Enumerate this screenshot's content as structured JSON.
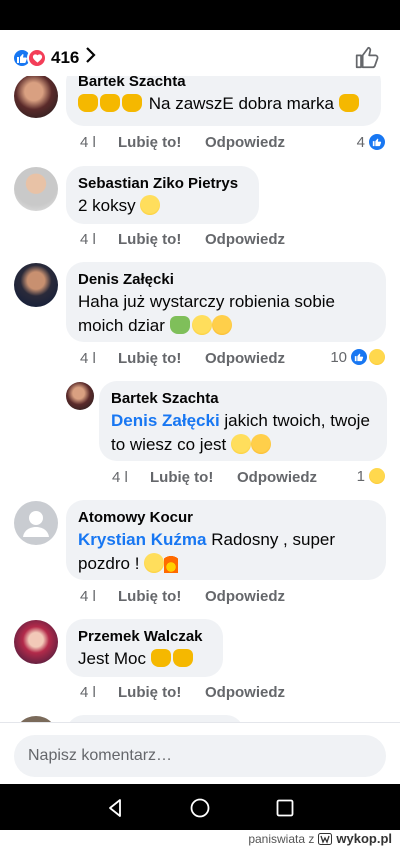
{
  "header": {
    "reaction_count": "416"
  },
  "actions": {
    "like": "Lubię to!",
    "reply": "Odpowiedz"
  },
  "comments": [
    {
      "author": "Bartek Szachta",
      "text": "Na zawszE dobra marka",
      "time": "4 l",
      "reactions": "4"
    },
    {
      "author": "Sebastian Ziko Pietrys",
      "text": "2 koksy",
      "time": "4 l"
    },
    {
      "author": "Denis Załęcki",
      "text": "Haha już wystarczy robienia sobie moich dziar",
      "time": "4 l",
      "reactions": "10"
    },
    {
      "author": "Bartek Szachta",
      "mention": "Denis Załęcki",
      "text": "jakich twoich, twoje to wiesz co jest",
      "time": "4 l",
      "reactions": "1"
    },
    {
      "author": "Atomowy Kocur",
      "mention": "Krystian Kuźma",
      "text": "Radosny , super pozdro !",
      "time": "4 l"
    },
    {
      "author": "Przemek Walczak",
      "text": "Jest Moc",
      "time": "4 l"
    }
  ],
  "composer": {
    "placeholder": "Napisz komentarz…"
  },
  "footer": {
    "credit": "paniswiata z",
    "site": "wykop.pl"
  }
}
